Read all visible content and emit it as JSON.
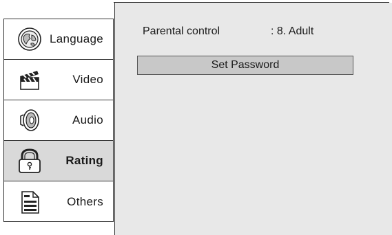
{
  "sidebar": {
    "items": [
      {
        "label": "Language",
        "icon": "globe-icon",
        "selected": false
      },
      {
        "label": "Video",
        "icon": "clapperboard-icon",
        "selected": false
      },
      {
        "label": "Audio",
        "icon": "speaker-icon",
        "selected": false
      },
      {
        "label": "Rating",
        "icon": "lock-icon",
        "selected": true
      },
      {
        "label": "Others",
        "icon": "document-icon",
        "selected": false
      }
    ]
  },
  "main": {
    "parental_control": {
      "label": "Parental control",
      "value": ": 8. Adult"
    },
    "set_password_button": "Set Password"
  },
  "colors": {
    "panel_bg": "#e8e8e8",
    "selected_bg": "#d9d9d9",
    "button_bg": "#c8c8c8",
    "border": "#333333"
  }
}
